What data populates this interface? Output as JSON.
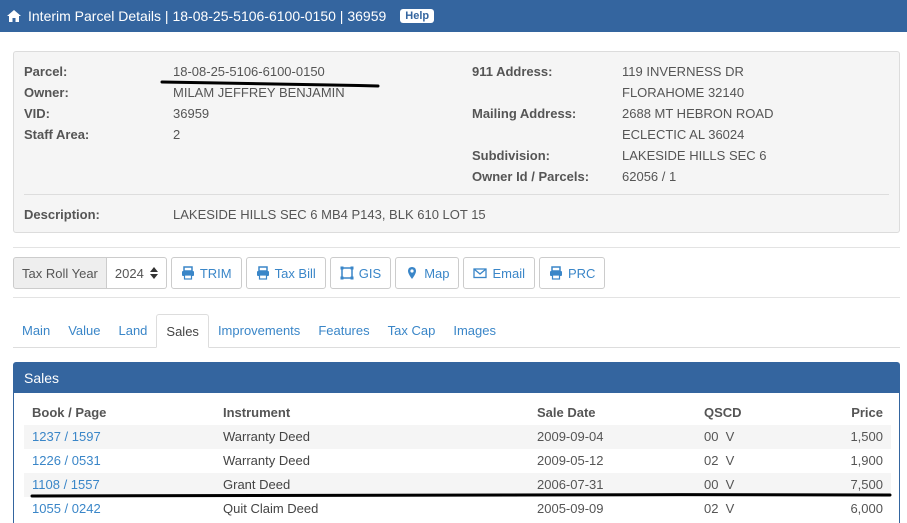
{
  "header": {
    "title": "Interim Parcel Details | 18-08-25-5106-6100-0150 | 36959",
    "help": "Help"
  },
  "details": {
    "parcel_label": "Parcel:",
    "parcel": "18-08-25-5106-6100-0150",
    "owner_label": "Owner:",
    "owner": "MILAM JEFFREY BENJAMIN",
    "vid_label": "VID:",
    "vid": "36959",
    "staff_label": "Staff Area:",
    "staff": "2",
    "addr911_label": "911 Address:",
    "addr911_line1": "119 INVERNESS DR",
    "addr911_line2": "FLORAHOME 32140",
    "mailing_label": "Mailing Address:",
    "mailing_line1": "2688 MT HEBRON ROAD",
    "mailing_line2": "ECLECTIC AL 36024",
    "subdivision_label": "Subdivision:",
    "subdivision": "LAKESIDE HILLS SEC 6",
    "ownerid_label": "Owner Id / Parcels:",
    "ownerid": "62056 / 1",
    "description_label": "Description:",
    "description": "LAKESIDE HILLS SEC 6 MB4 P143, BLK 610 LOT 15"
  },
  "toolbar": {
    "tax_roll_label": "Tax Roll Year",
    "year": "2024",
    "trim": "TRIM",
    "tax_bill": "Tax Bill",
    "gis": "GIS",
    "map": "Map",
    "email": "Email",
    "prc": "PRC"
  },
  "tabs": [
    "Main",
    "Value",
    "Land",
    "Sales",
    "Improvements",
    "Features",
    "Tax Cap",
    "Images"
  ],
  "active_tab": "Sales",
  "sales": {
    "title": "Sales",
    "columns": [
      "Book / Page",
      "Instrument",
      "Sale Date",
      "QSCD",
      "Price"
    ],
    "rows": [
      {
        "book_page": "1237 / 1597",
        "instrument": "Warranty Deed",
        "date": "2009-09-04",
        "qscd": "00  V",
        "price": "1,500"
      },
      {
        "book_page": "1226 / 0531",
        "instrument": "Warranty Deed",
        "date": "2009-05-12",
        "qscd": "02  V",
        "price": "1,900"
      },
      {
        "book_page": "1108 / 1557",
        "instrument": "Grant Deed",
        "date": "2006-07-31",
        "qscd": "00  V",
        "price": "7,500"
      },
      {
        "book_page": "1055 / 0242",
        "instrument": "Quit Claim Deed",
        "date": "2005-09-09",
        "qscd": "02  V",
        "price": "6,000"
      }
    ]
  },
  "colors": {
    "header_blue": "#34659f",
    "link_blue": "#3a86c8",
    "annotation_ink": "#000000"
  }
}
